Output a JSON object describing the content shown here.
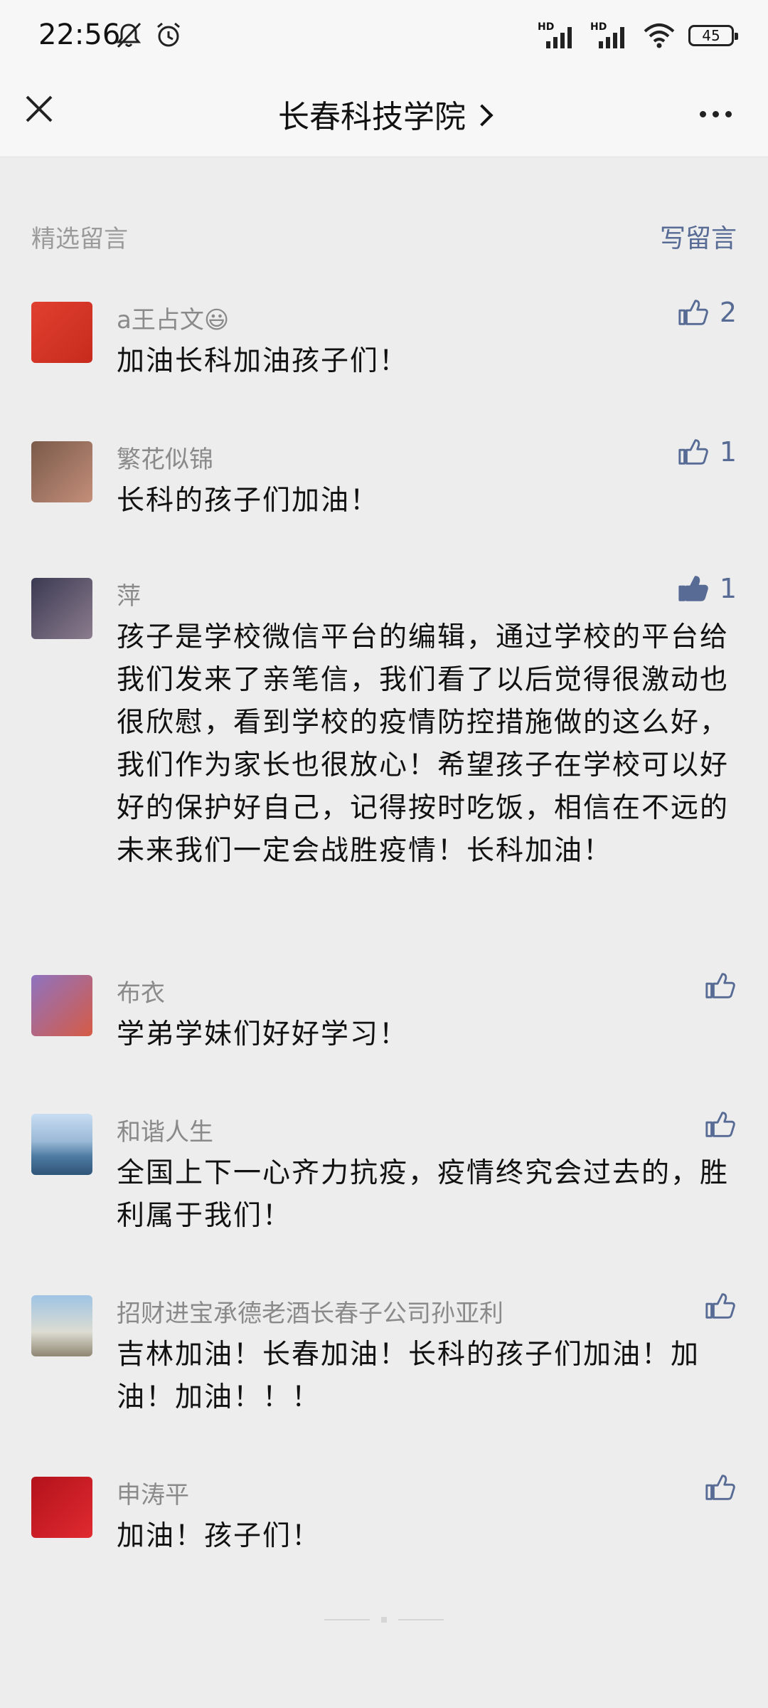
{
  "status_bar": {
    "time": "22:56",
    "icons": [
      "mute-icon",
      "alarm-icon",
      "signal-hd-icon",
      "signal-hd-icon",
      "wifi-icon",
      "battery-icon"
    ],
    "signal_1_label": "HD",
    "signal_2_label": "HD",
    "battery": "45"
  },
  "nav": {
    "close_icon": "close-icon",
    "title": "长春科技学院",
    "more_icon": "more-icon"
  },
  "section": {
    "label": "精选留言",
    "write_label": "写留言"
  },
  "colors": {
    "link": "#576b95",
    "background": "#ededed",
    "name_gray": "#8a8a8a"
  },
  "comments": [
    {
      "name": "a王占文😃",
      "text": "加油长科加油孩子们！",
      "likes": "2",
      "liked": false
    },
    {
      "name": "繁花似锦",
      "text": "长科的孩子们加油！",
      "likes": "1",
      "liked": false
    },
    {
      "name": "萍",
      "text": "孩子是学校微信平台的编辑，通过学校的平台给我们发来了亲笔信，我们看了以后觉得很激动也很欣慰，看到学校的疫情防控措施做的这么好，我们作为家长也很放心！希望孩子在学校可以好好的保护好自己，记得按时吃饭，相信在不远的未来我们一定会战胜疫情！长科加油！",
      "likes": "1",
      "liked": true
    },
    {
      "name": "布衣",
      "text": "学弟学妹们好好学习！",
      "likes": "",
      "liked": false
    },
    {
      "name": "和谐人生",
      "text": "全国上下一心齐力抗疫，疫情终究会过去的，胜利属于我们！",
      "likes": "",
      "liked": false
    },
    {
      "name": "招财进宝承德老酒长春子公司孙亚利",
      "text": "吉林加油！长春加油！长科的孩子们加油！加油！加油！！！",
      "likes": "",
      "liked": false
    },
    {
      "name": "申涛平",
      "text": "加油！孩子们！",
      "likes": "",
      "liked": false
    }
  ]
}
